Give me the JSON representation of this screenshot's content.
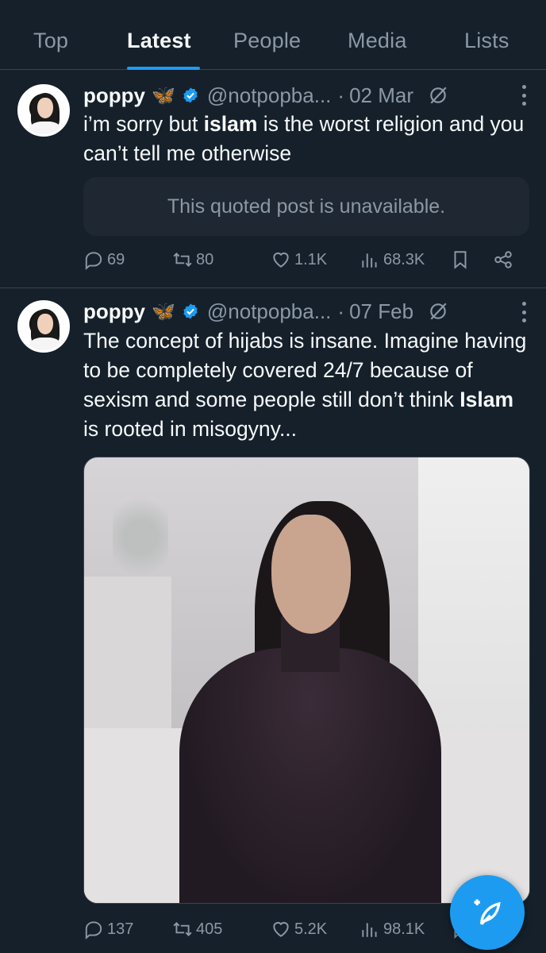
{
  "tabs": [
    {
      "label": "Top"
    },
    {
      "label": "Latest"
    },
    {
      "label": "People"
    },
    {
      "label": "Media"
    },
    {
      "label": "Lists"
    }
  ],
  "active_tab": "Latest",
  "accent_color": "#1d9bf0",
  "tweets": [
    {
      "name": "poppy",
      "emoji": "🦋",
      "handle": "@notpopba...",
      "separator": "·",
      "date": "02 Mar",
      "text_before": "i’m sorry but ",
      "text_bold": "islam",
      "text_after": " is the worst religion and you can’t tell me otherwise",
      "quote": "This quoted post is unavailable.",
      "replies": "69",
      "reposts": "80",
      "likes": "1.1K",
      "views": "68.3K"
    },
    {
      "name": "poppy",
      "emoji": "🦋",
      "handle": "@notpopba...",
      "separator": "·",
      "date": "07 Feb",
      "text_before": "The concept of hijabs is insane. Imagine having to be completely covered 24/7 because of sexism and some people still don’t think ",
      "text_bold": "Islam",
      "text_after": " is rooted in misogyny...",
      "replies": "137",
      "reposts": "405",
      "likes": "5.2K",
      "views": "98.1K"
    }
  ],
  "icons": [
    "verified-badge-icon",
    "grok-icon",
    "more-icon",
    "reply-icon",
    "repost-icon",
    "like-icon",
    "views-icon",
    "bookmark-icon",
    "share-icon",
    "compose-icon"
  ]
}
